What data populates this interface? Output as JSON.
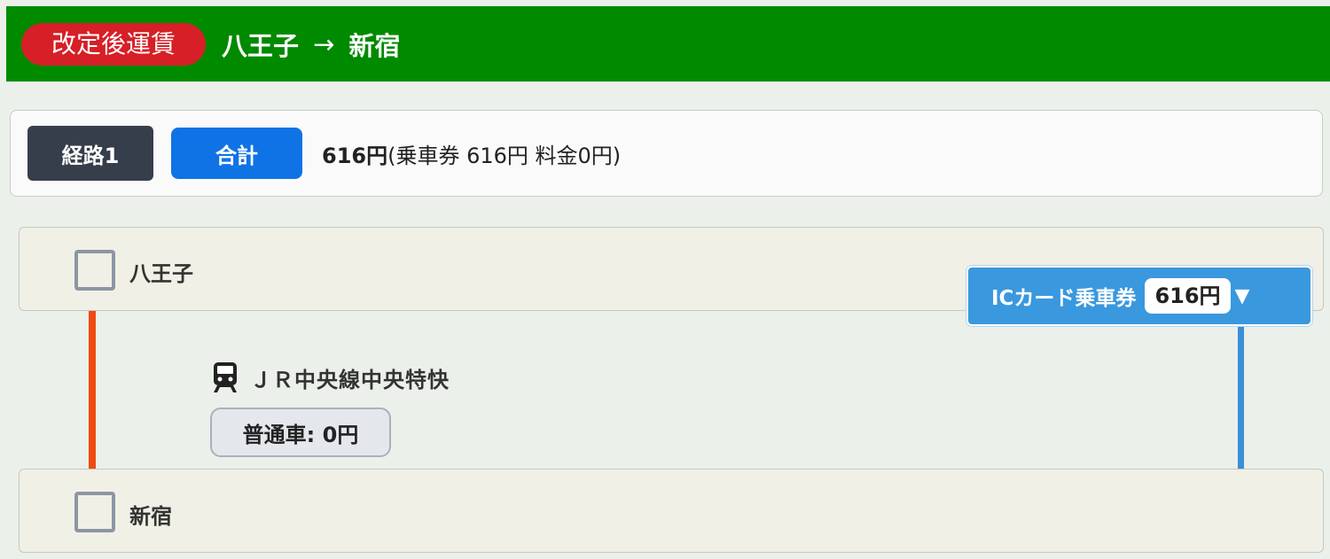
{
  "header": {
    "badge": "改定後運賃",
    "from": "八王子",
    "arrow": "→",
    "to": "新宿"
  },
  "summary": {
    "route_label": "経路1",
    "total_label": "合計",
    "total_amount": "616円",
    "total_detail": "(乗車券 616円 料金0円)"
  },
  "stations": {
    "from": "八王子",
    "to": "新宿"
  },
  "segment": {
    "line_name": "ＪＲ中央線中央特快",
    "fare_button": "普通車: 0円",
    "ic_label": "ICカード乗車券",
    "ic_price": "616円",
    "ic_caret": "▼"
  },
  "colors": {
    "header_bg": "#008a00",
    "badge_red": "#d61f26",
    "total_blue": "#0f73e6",
    "line_red": "#f04a14",
    "line_blue": "#3a8fd6"
  },
  "icons": {
    "train": "train-icon",
    "checkbox": "checkbox-square-icon"
  }
}
